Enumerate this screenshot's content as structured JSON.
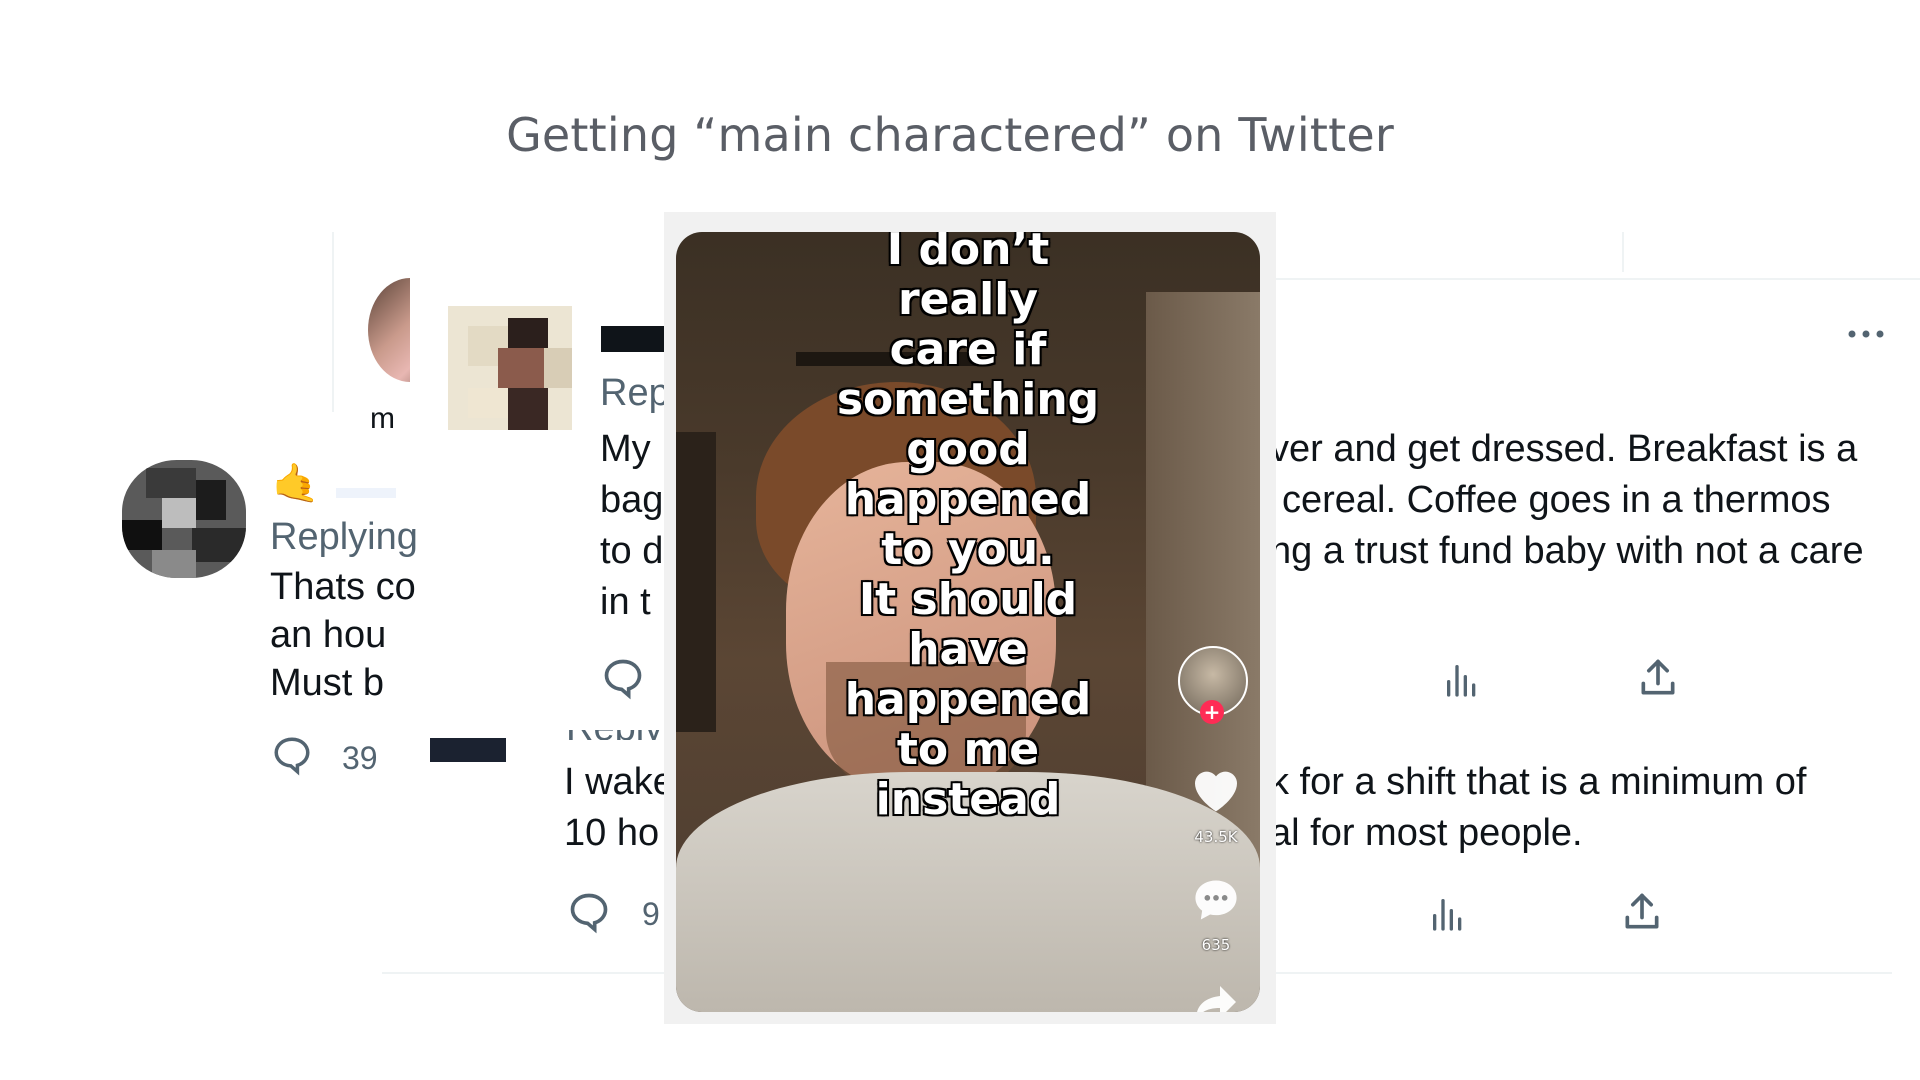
{
  "slide": {
    "title": "Getting “main charactered” on Twitter"
  },
  "back_tweet": {
    "fragment": "m",
    "reply_label_fragment": "Reply",
    "text_fragment_1": "I wake",
    "text_fragment_2": "10 ho",
    "reply_count_fragment": "9"
  },
  "middle_tweet": {
    "replying_fragment": "Rep",
    "text_fragments": [
      "My",
      "bag",
      "to d",
      "in t"
    ]
  },
  "front_tweet": {
    "emoji": "🤙",
    "replying_fragment": "Replying",
    "text_lines": [
      "Thats co",
      "an hou",
      "Must b"
    ],
    "reply_count": "39"
  },
  "right_tweet": {
    "line1": "ver and get dressed. Breakfast is a",
    "line2": "cereal. Coffee goes in a thermos",
    "line3": "ng a trust fund baby with not a care",
    "line4": "k for a shift that is a minimum of",
    "line5": "al for most people."
  },
  "tiktok": {
    "overlay_lines": [
      "I don’t",
      "really",
      "care if",
      "something",
      "good",
      "happened",
      "to you.",
      "It should",
      "have",
      "happened",
      "to me",
      "instead"
    ],
    "likes": "43.5K",
    "comments": "635"
  },
  "colors": {
    "tiktok_red": "#fe2c55",
    "twitter_gray": "#536471",
    "title_gray": "#5a5e66"
  }
}
